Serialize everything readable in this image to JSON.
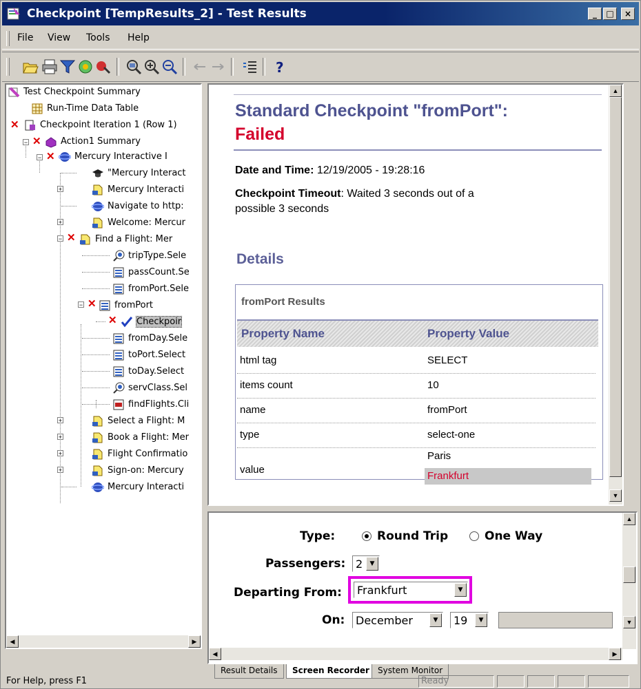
{
  "window": {
    "title": "Checkpoint [TempResults_2] - Test Results"
  },
  "menu": [
    "File",
    "View",
    "Tools",
    "Help"
  ],
  "toolbar": [
    "open-icon",
    "print-icon",
    "filter-icon",
    "find-icon",
    "report-icon",
    "zoom-icon",
    "zoom-in-icon",
    "zoom-out-icon",
    "back-icon",
    "forward-icon",
    "expand-icon",
    "help-icon"
  ],
  "tree": {
    "items": [
      "Test Checkpoint Summary",
      "Run-Time Data Table",
      "Checkpoint Iteration 1 (Row 1)",
      "Action1 Summary",
      "Mercury Interactive I",
      "\"Mercury Interact",
      "Mercury Interacti",
      "Navigate to http:",
      "Welcome: Mercur",
      "Find a Flight: Mer",
      "tripType.Sele",
      "passCount.Se",
      "fromPort.Sele",
      "fromPort",
      "Checkpoir",
      "fromDay.Sele",
      "toPort.Select",
      "toDay.Select",
      "servClass.Sel",
      "findFlights.Cli",
      "Select a Flight: M",
      "Book a Flight: Mer",
      "Flight Confirmatio",
      "Sign-on: Mercury",
      "Mercury Interacti"
    ]
  },
  "details": {
    "heading_line1": "Standard Checkpoint \"fromPort\":",
    "status": "Failed",
    "datetime_label": "Date and Time:",
    "datetime_value": " 12/19/2005 - 19:28:16",
    "timeout_label": "Checkpoint Timeout",
    "timeout_value_line1": ": Waited 3 seconds out of a",
    "timeout_value_line2": "possible 3 seconds",
    "section_title": "Details",
    "results_title": "fromPort Results",
    "col_name": "Property Name",
    "col_value": "Property Value",
    "rows": [
      {
        "name": "html tag",
        "value": "SELECT"
      },
      {
        "name": "items count",
        "value": "10"
      },
      {
        "name": "name",
        "value": "fromPort"
      },
      {
        "name": "type",
        "value": "select-one"
      },
      {
        "name": "value",
        "value": "Paris",
        "actual": "Frankfurt"
      }
    ]
  },
  "screen": {
    "type_label": "Type:",
    "round_trip": "Round Trip",
    "one_way": "One Way",
    "passengers_label": "Passengers:",
    "passengers_value": "2",
    "departing_label": "Departing From:",
    "departing_value": "Frankfurt",
    "on_label": "On:",
    "month": "December",
    "day": "19"
  },
  "tabs": [
    "Result Details",
    "Screen Recorder",
    "System Monitor"
  ],
  "statusbar": {
    "help": "For Help, press F1",
    "ready": "Ready"
  },
  "colors": {
    "titlebar": "#0a246a",
    "heading": "#4e5390",
    "failed": "#d4002c",
    "highlight": "#e000e0"
  }
}
